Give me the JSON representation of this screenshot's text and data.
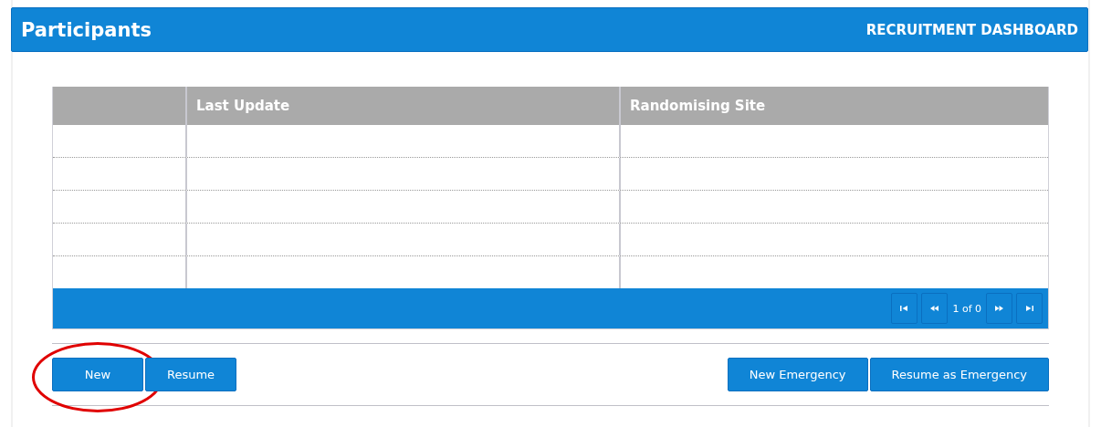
{
  "header": {
    "title": "Participants",
    "link": "RECRUITMENT DASHBOARD"
  },
  "table": {
    "columns": [
      "",
      "Last Update",
      "Randomising Site"
    ],
    "pager": {
      "text": "1 of 0"
    }
  },
  "buttons_left": [
    {
      "label": "New",
      "circled": true
    },
    {
      "label": "Resume",
      "circled": false
    }
  ],
  "buttons_right": [
    {
      "label": "New Emergency",
      "circled": false
    },
    {
      "label": "Resume as Emergency",
      "circled": false
    }
  ]
}
